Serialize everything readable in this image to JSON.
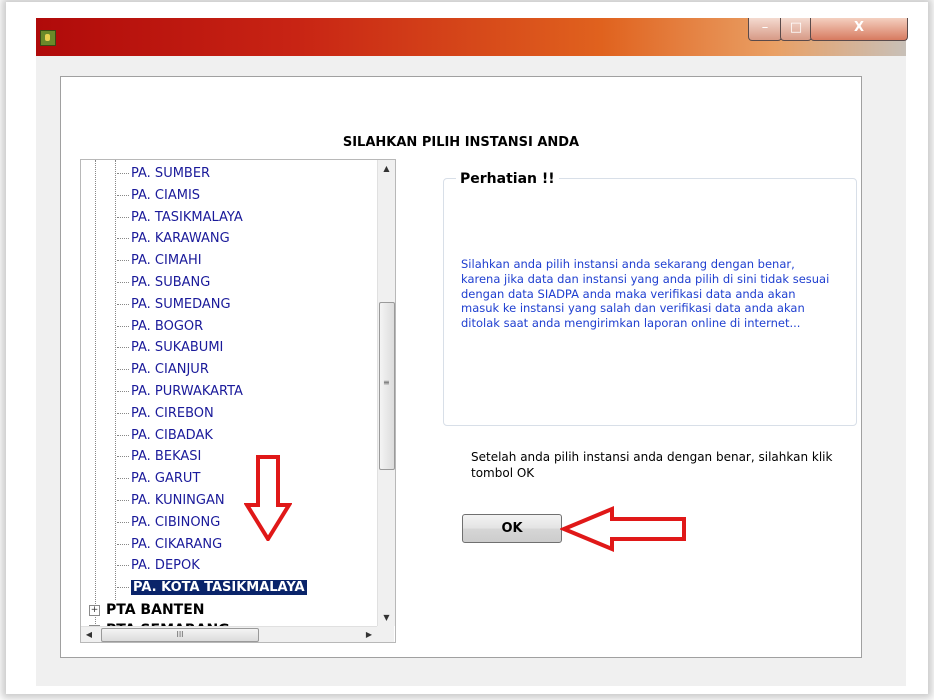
{
  "heading": "SILAHKAN PILIH INSTANSI ANDA",
  "tree": {
    "children": [
      "PA. SUMBER",
      "PA. CIAMIS",
      "PA. TASIKMALAYA",
      "PA. KARAWANG",
      "PA. CIMAHI",
      "PA. SUBANG",
      "PA. SUMEDANG",
      "PA. BOGOR",
      "PA. SUKABUMI",
      "PA. CIANJUR",
      "PA. PURWAKARTA",
      "PA. CIREBON",
      "PA. CIBADAK",
      "PA. BEKASI",
      "PA. GARUT",
      "PA. KUNINGAN",
      "PA. CIBINONG",
      "PA. CIKARANG",
      "PA. DEPOK",
      "PA. KOTA TASIKMALAYA"
    ],
    "selected_index": 19,
    "parents": [
      "PTA BANTEN",
      "PTA SEMARANG"
    ],
    "expand_glyph": "+",
    "hscroll_grip": "III",
    "vscroll_grip": "≡"
  },
  "notice": {
    "title": "Perhatian !!",
    "text": "Silahkan anda pilih instansi anda sekarang dengan benar, karena jika data dan instansi yang anda pilih di sini tidak sesuai dengan data SIADPA anda maka verifikasi data anda akan masuk ke instansi yang salah dan verifikasi data anda akan ditolak saat anda mengirimkan laporan online di internet..."
  },
  "instruction": "Setelah anda pilih instansi anda dengan benar, silahkan klik tombol OK",
  "ok_label": "OK",
  "window_controls": {
    "minimize": "–",
    "maximize": "□",
    "close": "X"
  },
  "colors": {
    "titlebar_start": "#b00a0a",
    "selection": "#0a246a",
    "tree_text": "#1a1a9a",
    "notice_text": "#1f3fd0",
    "annotation_arrow": "#e01818"
  }
}
